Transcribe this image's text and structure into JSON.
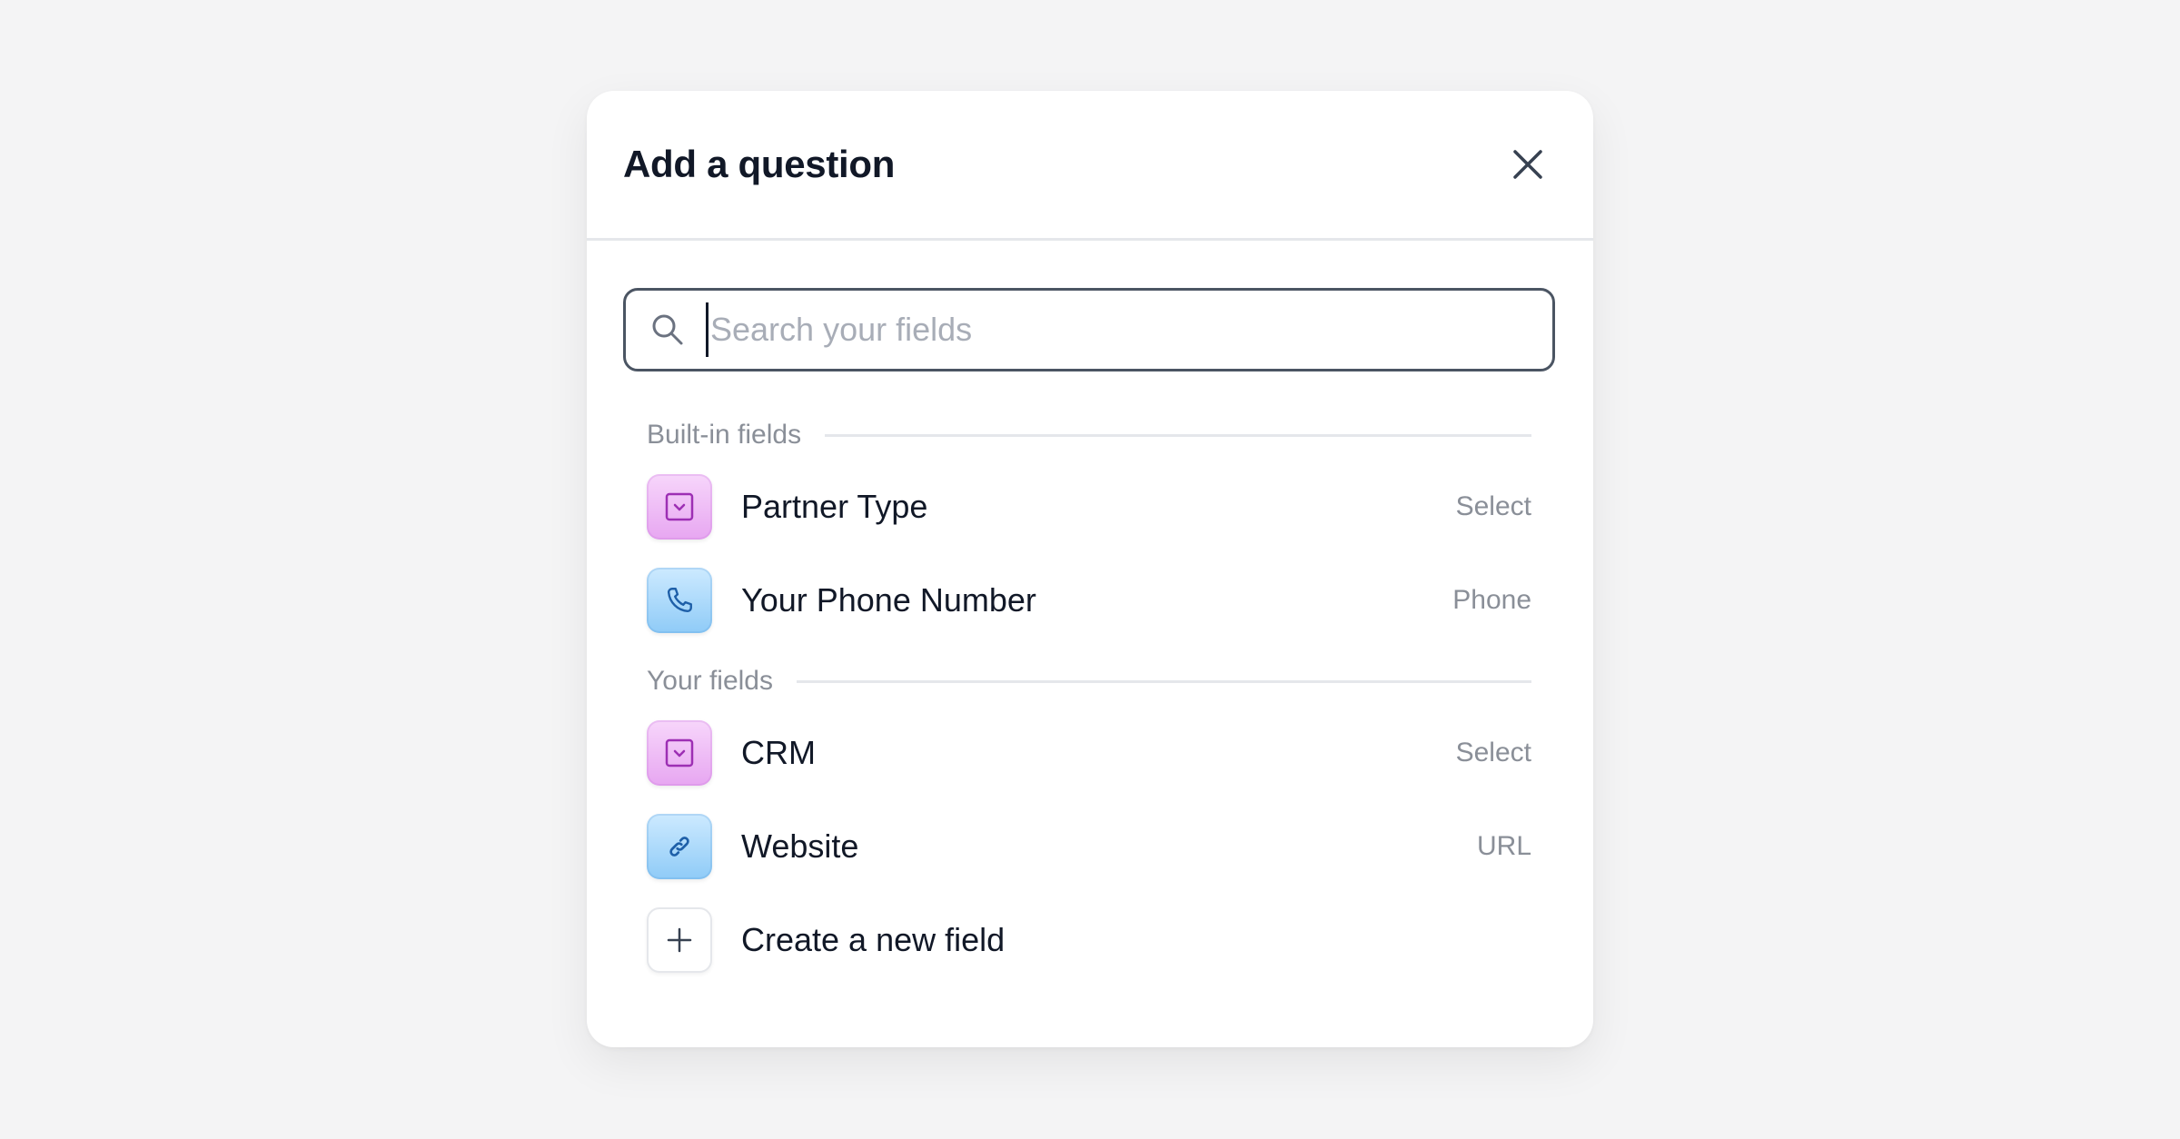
{
  "modal": {
    "title": "Add a question",
    "close_icon": "close-icon"
  },
  "search": {
    "placeholder": "Search your fields",
    "value": "",
    "icon": "search-icon"
  },
  "sections": {
    "builtin": {
      "label": "Built-in fields",
      "items": [
        {
          "name": "Partner Type",
          "type": "Select",
          "icon": "select-dropdown-icon",
          "color": "#e7a6f1"
        },
        {
          "name": "Your Phone Number",
          "type": "Phone",
          "icon": "phone-icon",
          "color": "#8fcbf7"
        }
      ]
    },
    "yours": {
      "label": "Your fields",
      "items": [
        {
          "name": "CRM",
          "type": "Select",
          "icon": "select-dropdown-icon",
          "color": "#e7a6f1"
        },
        {
          "name": "Website",
          "type": "URL",
          "icon": "link-icon",
          "color": "#8fcbf7"
        }
      ]
    }
  },
  "create": {
    "label": "Create a new field",
    "icon": "plus-icon"
  },
  "colors": {
    "background": "#f4f4f5",
    "text": "#111827",
    "muted": "#8a8f98",
    "border": "#e5e7eb",
    "input_border": "#4b5563"
  }
}
